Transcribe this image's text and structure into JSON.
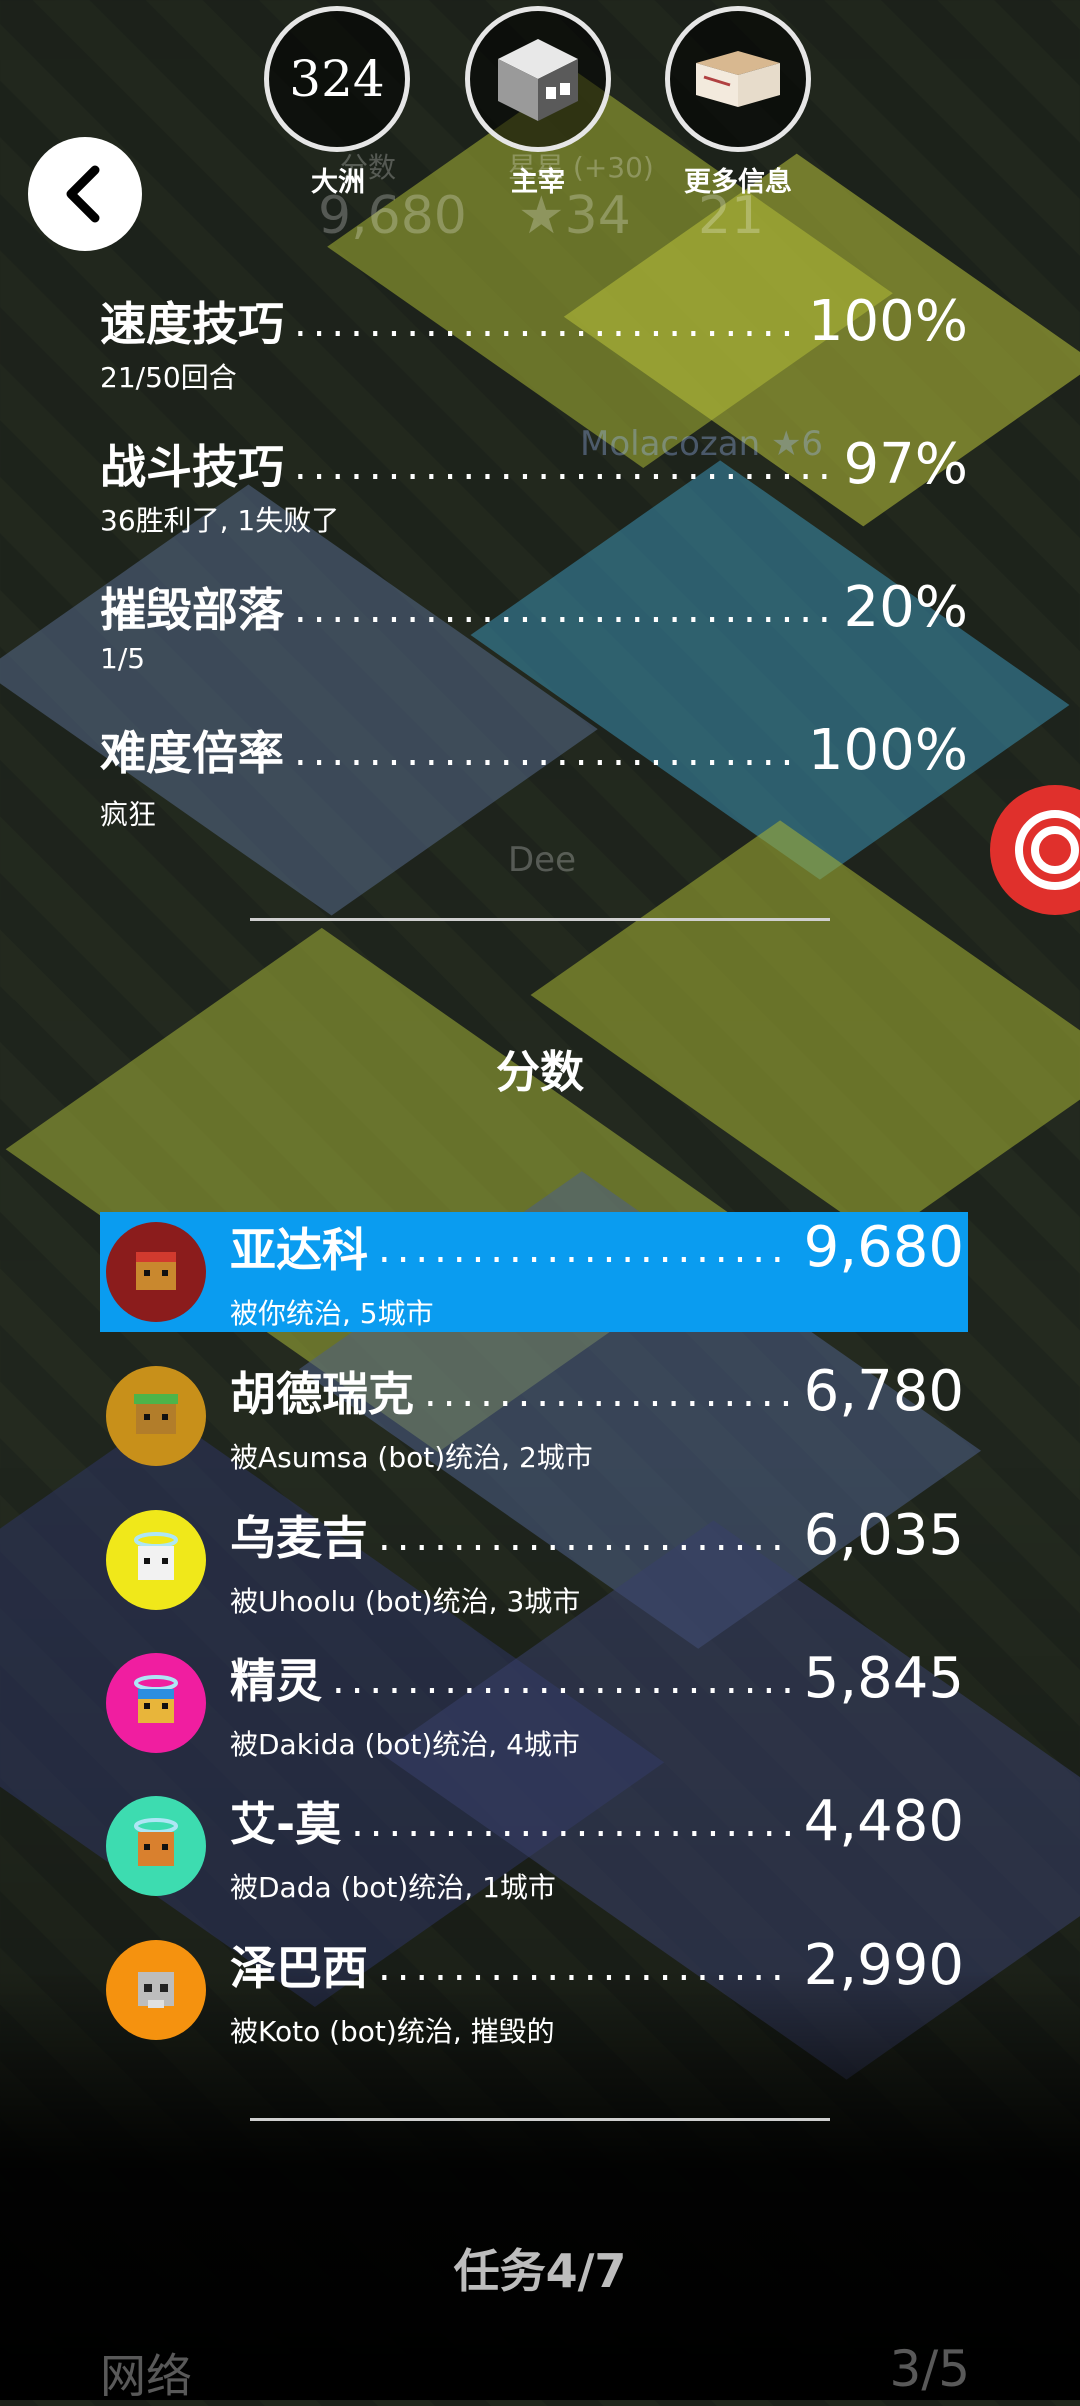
{
  "top_buttons": [
    {
      "value": "324",
      "label": "大洲"
    },
    {
      "value": "",
      "label": "主宰"
    },
    {
      "value": "",
      "label": "更多信息"
    }
  ],
  "background_hud": {
    "score_label": "分数",
    "score_value": "9,680",
    "stars_label": "星星 (+30)",
    "stars_value": "★34",
    "turn_value": "21",
    "player_tag": "Molacozan ★6",
    "city_tag": "Dee"
  },
  "stats": [
    {
      "name": "速度技巧",
      "value": "100%",
      "sub": "21/50回合"
    },
    {
      "name": "战斗技巧",
      "value": "97%",
      "sub": "36胜利了, 1失败了"
    },
    {
      "name": "摧毁部落",
      "value": "20%",
      "sub": "1/5"
    },
    {
      "name": "难度倍率",
      "value": "100%",
      "sub": "疯狂"
    }
  ],
  "score_section_title": "分数",
  "scores": [
    {
      "name": "亚达科",
      "value": "9,680",
      "sub": "被你统治, 5城市",
      "avatar_color": "#8b1c1c",
      "highlight": true
    },
    {
      "name": "胡德瑞克",
      "value": "6,780",
      "sub": "被Asumsa (bot)统治, 2城市",
      "avatar_color": "#c8901a",
      "highlight": false
    },
    {
      "name": "乌麦吉",
      "value": "6,035",
      "sub": "被Uhoolu (bot)统治, 3城市",
      "avatar_color": "#f0e81a",
      "highlight": false
    },
    {
      "name": "精灵",
      "value": "5,845",
      "sub": "被Dakida (bot)统治, 4城市",
      "avatar_color": "#f01ea0",
      "highlight": false
    },
    {
      "name": "艾-莫",
      "value": "4,480",
      "sub": "被Dada (bot)统治, 1城市",
      "avatar_color": "#3ddcb0",
      "highlight": false
    },
    {
      "name": "泽巴西",
      "value": "2,990",
      "sub": "被Koto (bot)统治, 摧毁的",
      "avatar_color": "#f5920f",
      "highlight": false
    }
  ],
  "mission": "任务4/7",
  "network": {
    "label": "网络",
    "value": "3/5"
  },
  "colors": {
    "highlight": "#0a9cf0",
    "divider": "#cfcfcf"
  }
}
